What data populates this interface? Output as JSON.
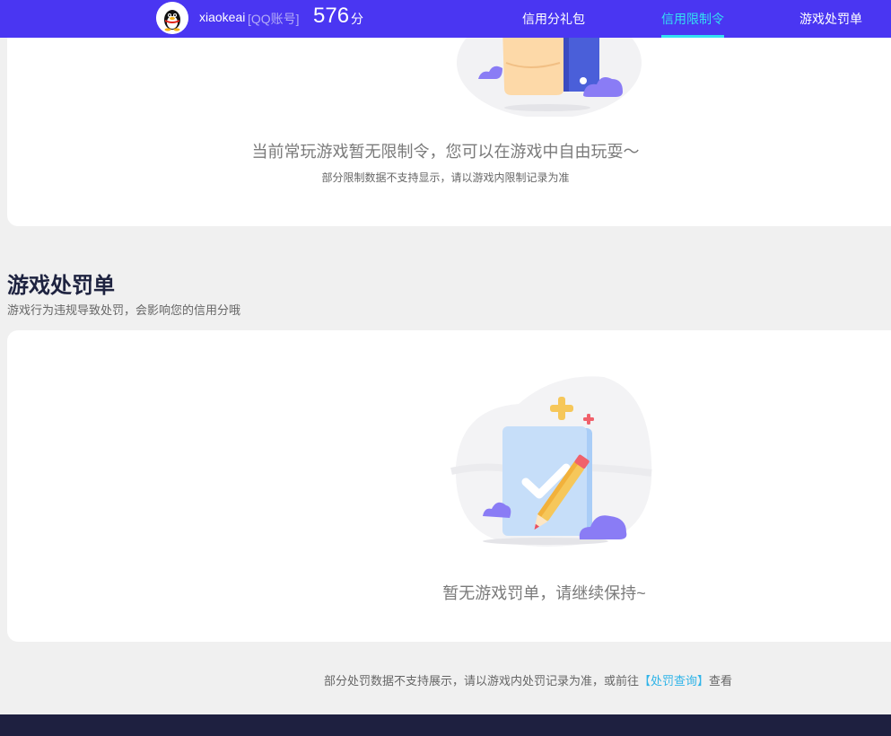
{
  "header": {
    "username": "xiaokeai",
    "account_type": "[QQ账号]",
    "score": "576",
    "score_unit": "分",
    "nav": [
      {
        "label": "信用分礼包",
        "active": false
      },
      {
        "label": "信用限制令",
        "active": true
      },
      {
        "label": "游戏处罚单",
        "active": false
      }
    ],
    "accent_color": "#4a36f2",
    "active_color": "#33e0f2"
  },
  "restriction": {
    "message": "当前常玩游戏暂无限制令，您可以在游戏中自由玩耍～",
    "note": "部分限制数据不支持显示，请以游戏内限制记录为准",
    "illustration": "thumbs-up-illustration"
  },
  "penalty": {
    "title": "游戏处罚单",
    "subtitle": "游戏行为违规导致处罚，会影响您的信用分哦",
    "empty_message": "暂无游戏罚单，请继续保持~",
    "illustration": "checklist-pencil-illustration",
    "footer_prefix": "部分处罚数据不支持展示，请以游戏内处罚记录为准，或前往",
    "footer_link": "【处罚查询】",
    "footer_suffix": "查看",
    "link_color": "#2fb4e8"
  }
}
